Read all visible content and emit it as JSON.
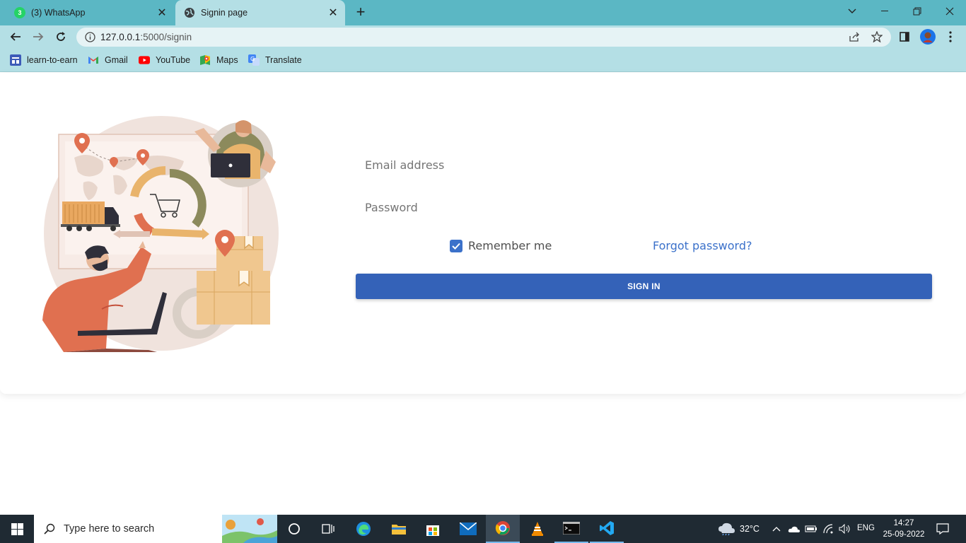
{
  "browser": {
    "tabs": [
      {
        "title": "(3) WhatsApp",
        "badge": "3",
        "icon": "whatsapp-icon",
        "active": false
      },
      {
        "title": "Signin page",
        "icon": "globe-icon",
        "active": true
      }
    ],
    "address": {
      "host": "127.0.0.1",
      "path": ":5000/signin"
    },
    "bookmarks": [
      {
        "label": "learn-to-earn",
        "icon": "site-icon"
      },
      {
        "label": "Gmail",
        "icon": "gmail-icon"
      },
      {
        "label": "YouTube",
        "icon": "youtube-icon"
      },
      {
        "label": "Maps",
        "icon": "maps-icon"
      },
      {
        "label": "Translate",
        "icon": "translate-icon"
      }
    ]
  },
  "signin": {
    "email_label": "Email address",
    "password_label": "Password",
    "remember_label": "Remember me",
    "remember_checked": true,
    "forgot_label": "Forgot password?",
    "submit_label": "SIGN IN"
  },
  "taskbar": {
    "search_placeholder": "Type here to search",
    "weather": "32°C",
    "language": "ENG",
    "time": "14:27",
    "date": "25-09-2022"
  },
  "colors": {
    "tabstrip": "#5bb7c4",
    "toolbar": "#b4dfe5",
    "primary": "#3462b8",
    "link": "#3b71ca",
    "taskbar": "#1f2a33"
  }
}
